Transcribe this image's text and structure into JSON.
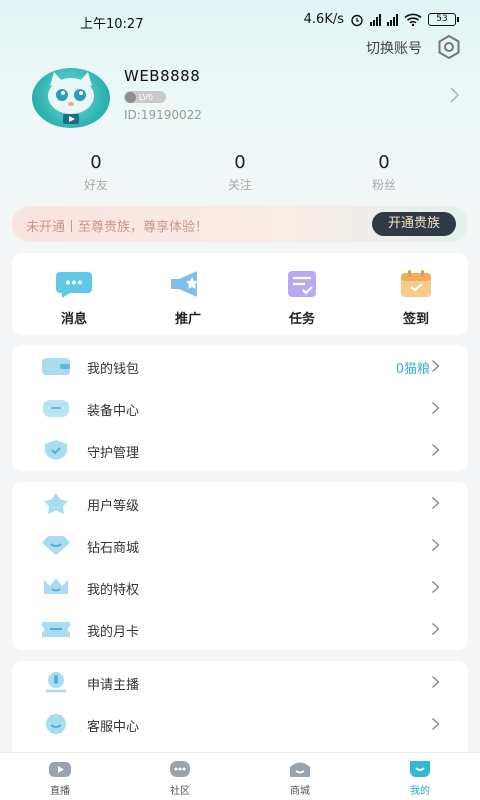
{
  "status_bar": {
    "time": "上午10:27",
    "net_speed": "4.6K/s",
    "battery": "53"
  },
  "header": {
    "switch_account": "切换账号"
  },
  "profile": {
    "username": "WEB8888",
    "level_badge": "LV0",
    "user_id": "ID:19190022"
  },
  "stats": [
    {
      "value": "0",
      "label": "好友"
    },
    {
      "value": "0",
      "label": "关注"
    },
    {
      "value": "0",
      "label": "粉丝"
    }
  ],
  "vip_banner": {
    "text": "未开通丨至尊贵族，尊享体验！",
    "button": "开通贵族"
  },
  "quick_actions": [
    {
      "label": "消息",
      "icon": "message-icon"
    },
    {
      "label": "推广",
      "icon": "promote-icon"
    },
    {
      "label": "任务",
      "icon": "task-icon"
    },
    {
      "label": "签到",
      "icon": "checkin-icon"
    }
  ],
  "menu_group_1": [
    {
      "label": "我的钱包",
      "value": "0猫粮",
      "icon": "wallet-icon"
    },
    {
      "label": "装备中心",
      "value": "",
      "icon": "equipment-icon"
    },
    {
      "label": "守护管理",
      "value": "",
      "icon": "shield-icon"
    }
  ],
  "menu_group_2": [
    {
      "label": "用户等级",
      "icon": "star-icon"
    },
    {
      "label": "钻石商城",
      "icon": "diamond-icon"
    },
    {
      "label": "我的特权",
      "icon": "crown-icon"
    },
    {
      "label": "我的月卡",
      "icon": "ticket-icon"
    }
  ],
  "menu_group_3": [
    {
      "label": "申请主播",
      "icon": "anchor-icon"
    },
    {
      "label": "客服中心",
      "icon": "service-icon"
    }
  ],
  "tab_bar": [
    {
      "label": "直播",
      "icon": "live-icon"
    },
    {
      "label": "社区",
      "icon": "community-icon"
    },
    {
      "label": "商城",
      "icon": "shop-icon"
    },
    {
      "label": "我的",
      "icon": "mine-icon",
      "active": true
    }
  ],
  "colors": {
    "accent": "#3ab3c9",
    "vip_button_bg": "#2f3a45",
    "vip_text": "#c8968c"
  }
}
